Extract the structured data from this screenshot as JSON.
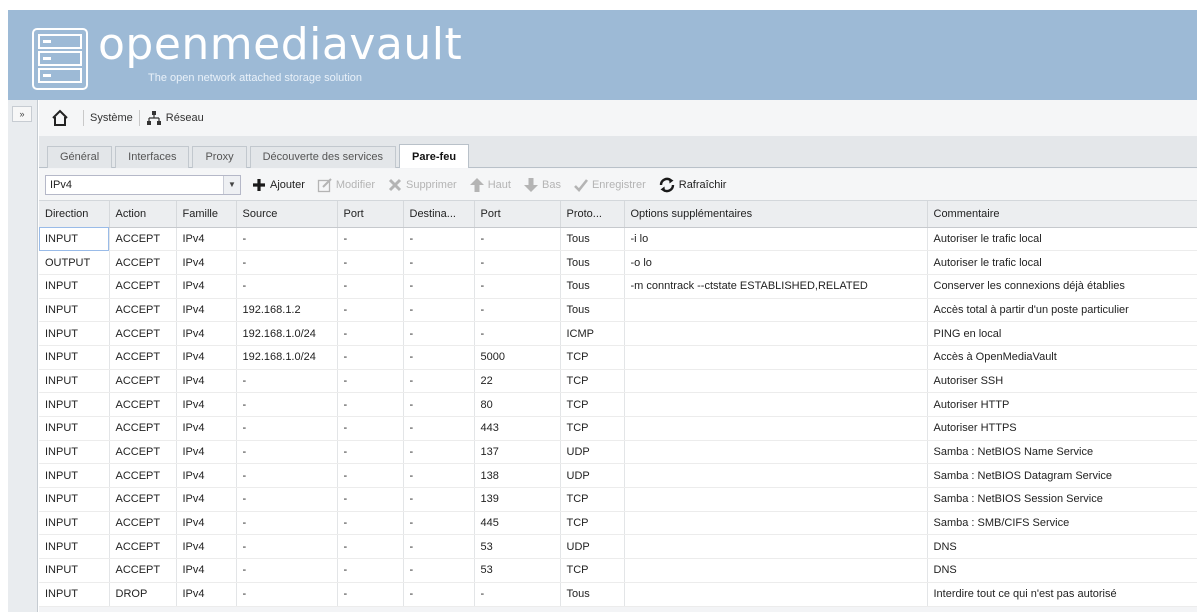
{
  "header": {
    "brand": "openmediavault",
    "tagline": "The open network attached storage solution"
  },
  "left_strip": {
    "toggle_label": "»"
  },
  "breadcrumb": {
    "item1": "Système",
    "item2": "Réseau"
  },
  "tabs": [
    {
      "label": "Général"
    },
    {
      "label": "Interfaces"
    },
    {
      "label": "Proxy"
    },
    {
      "label": "Découverte des services"
    },
    {
      "label": "Pare-feu"
    }
  ],
  "toolbar": {
    "select_value": "IPv4",
    "add": "Ajouter",
    "edit": "Modifier",
    "delete": "Supprimer",
    "up": "Haut",
    "down": "Bas",
    "save": "Enregistrer",
    "refresh": "Rafraîchir"
  },
  "table": {
    "columns": [
      "Direction",
      "Action",
      "Famille",
      "Source",
      "Port",
      "Destina...",
      "Port",
      "Proto...",
      "Options supplémentaires",
      "Commentaire"
    ],
    "rows": [
      [
        "INPUT",
        "ACCEPT",
        "IPv4",
        "-",
        "-",
        "-",
        "-",
        "Tous",
        "-i lo",
        "Autoriser le trafic local"
      ],
      [
        "OUTPUT",
        "ACCEPT",
        "IPv4",
        "-",
        "-",
        "-",
        "-",
        "Tous",
        "-o lo",
        "Autoriser le trafic local"
      ],
      [
        "INPUT",
        "ACCEPT",
        "IPv4",
        "-",
        "-",
        "-",
        "-",
        "Tous",
        "-m conntrack --ctstate ESTABLISHED,RELATED",
        "Conserver les connexions déjà établies"
      ],
      [
        "INPUT",
        "ACCEPT",
        "IPv4",
        "192.168.1.2",
        "-",
        "-",
        "-",
        "Tous",
        "",
        "Accès total à partir d'un poste particulier"
      ],
      [
        "INPUT",
        "ACCEPT",
        "IPv4",
        "192.168.1.0/24",
        "-",
        "-",
        "-",
        "ICMP",
        "",
        "PING en local"
      ],
      [
        "INPUT",
        "ACCEPT",
        "IPv4",
        "192.168.1.0/24",
        "-",
        "-",
        "5000",
        "TCP",
        "",
        "Accès à OpenMediaVault"
      ],
      [
        "INPUT",
        "ACCEPT",
        "IPv4",
        "-",
        "-",
        "-",
        "22",
        "TCP",
        "",
        "Autoriser SSH"
      ],
      [
        "INPUT",
        "ACCEPT",
        "IPv4",
        "-",
        "-",
        "-",
        "80",
        "TCP",
        "",
        "Autoriser HTTP"
      ],
      [
        "INPUT",
        "ACCEPT",
        "IPv4",
        "-",
        "-",
        "-",
        "443",
        "TCP",
        "",
        "Autoriser HTTPS"
      ],
      [
        "INPUT",
        "ACCEPT",
        "IPv4",
        "-",
        "-",
        "-",
        "137",
        "UDP",
        "",
        "Samba : NetBIOS Name Service"
      ],
      [
        "INPUT",
        "ACCEPT",
        "IPv4",
        "-",
        "-",
        "-",
        "138",
        "UDP",
        "",
        "Samba : NetBIOS Datagram Service"
      ],
      [
        "INPUT",
        "ACCEPT",
        "IPv4",
        "-",
        "-",
        "-",
        "139",
        "TCP",
        "",
        "Samba : NetBIOS Session Service"
      ],
      [
        "INPUT",
        "ACCEPT",
        "IPv4",
        "-",
        "-",
        "-",
        "445",
        "TCP",
        "",
        "Samba : SMB/CIFS Service"
      ],
      [
        "INPUT",
        "ACCEPT",
        "IPv4",
        "-",
        "-",
        "-",
        "53",
        "UDP",
        "",
        "DNS"
      ],
      [
        "INPUT",
        "ACCEPT",
        "IPv4",
        "-",
        "-",
        "-",
        "53",
        "TCP",
        "",
        "DNS"
      ],
      [
        "INPUT",
        "DROP",
        "IPv4",
        "-",
        "-",
        "-",
        "-",
        "Tous",
        "",
        "Interdire tout ce qui n'est pas autorisé"
      ]
    ]
  },
  "colors": {
    "header_bg": "#9dbad6",
    "add_icon": "#1a1a1a",
    "disabled": "#b4b4b4"
  },
  "icons": {
    "logo": "server-stack-icon",
    "home": "home-icon",
    "network": "network-icon",
    "add": "plus-icon",
    "edit": "pencil-icon",
    "delete": "x-icon",
    "up": "arrow-up-icon",
    "down": "arrow-down-icon",
    "save": "checkmark-icon",
    "refresh": "refresh-icon"
  }
}
